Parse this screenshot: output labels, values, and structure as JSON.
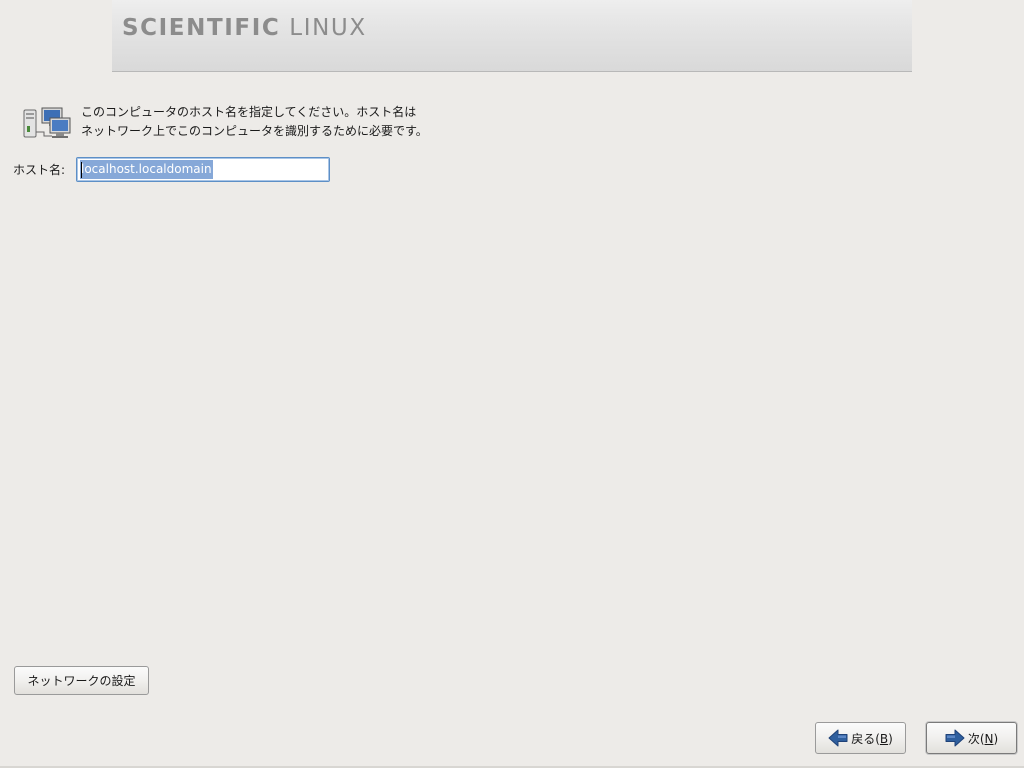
{
  "banner": {
    "brand_primary": "SCIENTIFIC",
    "brand_secondary": "LINUX"
  },
  "description": {
    "line1": "このコンピュータのホスト名を指定してください。ホスト名は",
    "line2": "ネットワーク上でこのコンピュータを識別するために必要です。"
  },
  "hostname": {
    "label": "ホスト名:",
    "value": "localhost.localdomain"
  },
  "buttons": {
    "network_config": "ネットワークの設定",
    "back_prefix": "戻る(",
    "back_mnemonic": "B",
    "back_suffix": ")",
    "next_prefix": "次(",
    "next_mnemonic": "N",
    "next_suffix": ")"
  },
  "icons": {
    "host": "network-computers-icon",
    "back": "arrow-left-icon",
    "next": "arrow-right-icon"
  },
  "colors": {
    "background": "#edebe8",
    "selection": "#86a8d8",
    "focus_border": "#5d8fc6",
    "arrow_blue": "#2f5f9e"
  }
}
